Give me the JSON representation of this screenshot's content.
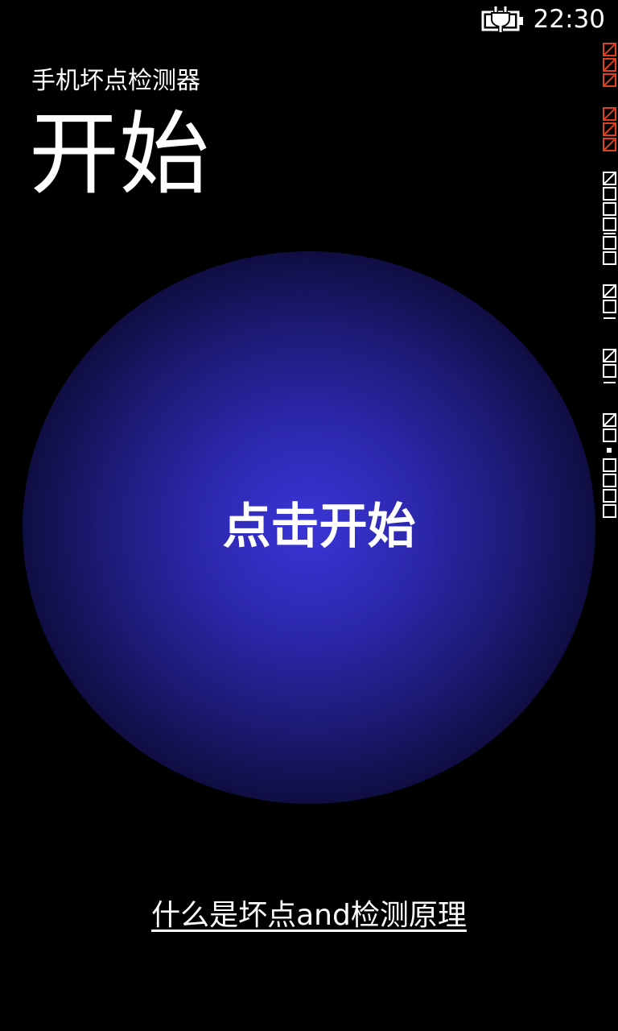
{
  "status_bar": {
    "time": "22:30",
    "battery_icon": "battery-charging-icon"
  },
  "header": {
    "app_name": "手机坏点检测器",
    "page_title": "开始"
  },
  "main": {
    "start_button_label": "点击开始"
  },
  "footer": {
    "info_link_label": "什么是坏点and检测原理"
  },
  "colors": {
    "background": "#000000",
    "glow_center": "#3a35d4",
    "text": "#ffffff",
    "counter_red": "#e0401c",
    "counter_white": "#ffffff"
  }
}
